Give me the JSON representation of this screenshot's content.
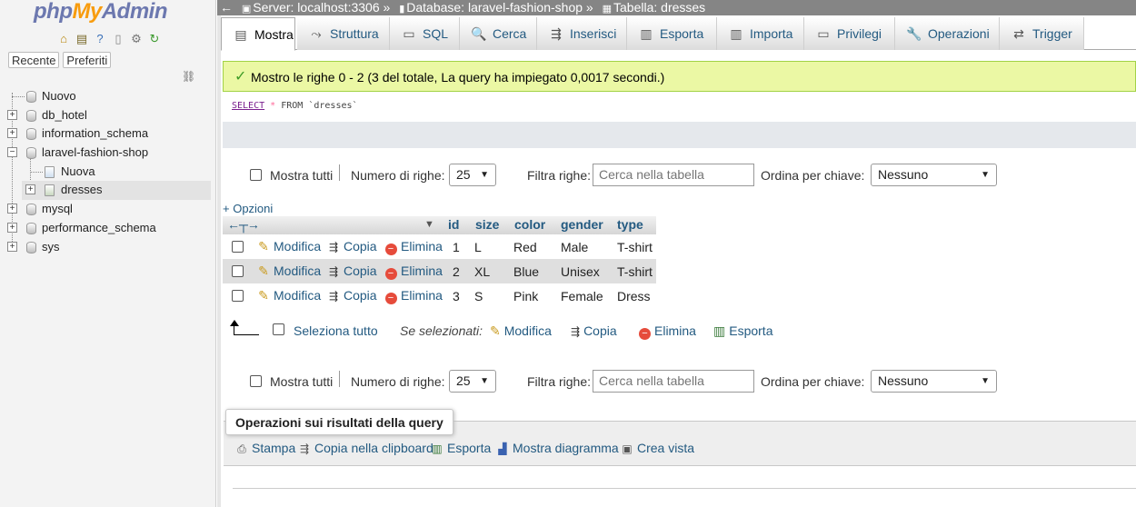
{
  "sidebar": {
    "logo": {
      "php": "php",
      "my": "My",
      "admin": "Admin"
    },
    "icons": [
      "home-icon",
      "exit-icon",
      "help-icon",
      "docs-icon",
      "settings-icon",
      "reload-icon"
    ],
    "tabs": {
      "recent": "Recente",
      "favorites": "Preferiti"
    },
    "tree": [
      {
        "label": "Nuovo",
        "type": "new"
      },
      {
        "label": "db_hotel",
        "type": "db"
      },
      {
        "label": "information_schema",
        "type": "db"
      },
      {
        "label": "laravel-fashion-shop",
        "type": "db",
        "expanded": true
      },
      {
        "label": "Nuova",
        "type": "new-table"
      },
      {
        "label": "dresses",
        "type": "table",
        "selected": true
      },
      {
        "label": "mysql",
        "type": "db"
      },
      {
        "label": "performance_schema",
        "type": "db"
      },
      {
        "label": "sys",
        "type": "db"
      }
    ]
  },
  "breadcrumb": {
    "back": "←",
    "server": "Server: localhost:3306",
    "sep1": "»",
    "database": "Database: laravel-fashion-shop",
    "sep2": "»",
    "table": "Tabella: dresses"
  },
  "tabs": [
    {
      "label": "Mostra",
      "icon": "browse-icon",
      "active": true
    },
    {
      "label": "Struttura",
      "icon": "structure-icon"
    },
    {
      "label": "SQL",
      "icon": "sql-icon"
    },
    {
      "label": "Cerca",
      "icon": "search-icon"
    },
    {
      "label": "Inserisci",
      "icon": "insert-icon"
    },
    {
      "label": "Esporta",
      "icon": "export-icon"
    },
    {
      "label": "Importa",
      "icon": "import-icon"
    },
    {
      "label": "Privilegi",
      "icon": "privileges-icon"
    },
    {
      "label": "Operazioni",
      "icon": "wrench-icon"
    },
    {
      "label": "Trigger",
      "icon": "trigger-icon"
    }
  ],
  "success_message": "Mostro le righe 0 - 2 (3 del totale, La query ha impiegato 0,0017 secondi.)",
  "sql": {
    "select": "SELECT",
    "star": "*",
    "from": "FROM",
    "table": "`dresses`"
  },
  "nav": {
    "show_all": "Mostra tutti",
    "num_rows_label": "Numero di righe:",
    "num_rows_value": "25",
    "filter_label": "Filtra righe:",
    "filter_placeholder": "Cerca nella tabella",
    "sort_label": "Ordina per chiave:",
    "sort_value": "Nessuno"
  },
  "options_link": "+ Opzioni",
  "table": {
    "headers": [
      "id",
      "size",
      "color",
      "gender",
      "type"
    ],
    "actions": {
      "edit": "Modifica",
      "copy": "Copia",
      "delete": "Elimina"
    },
    "rows": [
      {
        "id": "1",
        "size": "L",
        "color": "Red",
        "gender": "Male",
        "type": "T-shirt"
      },
      {
        "id": "2",
        "size": "XL",
        "color": "Blue",
        "gender": "Unisex",
        "type": "T-shirt"
      },
      {
        "id": "3",
        "size": "S",
        "color": "Pink",
        "gender": "Female",
        "type": "Dress"
      }
    ]
  },
  "bulk": {
    "select_all": "Seleziona tutto",
    "with_selected": "Se selezionati:",
    "edit": "Modifica",
    "copy": "Copia",
    "delete": "Elimina",
    "export": "Esporta"
  },
  "query_ops": {
    "legend": "Operazioni sui risultati della query",
    "items": [
      "Stampa",
      "Copia nella clipboard",
      "Esporta",
      "Mostra diagramma",
      "Crea vista"
    ]
  },
  "colors": {
    "accent": "#235a81",
    "success_bg": "#ebf8a4",
    "breadcrumb_bg": "#858585"
  }
}
